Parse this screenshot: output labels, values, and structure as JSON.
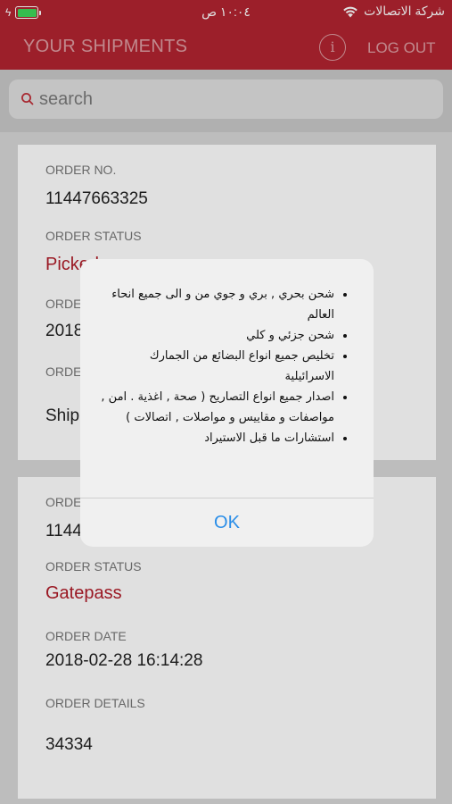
{
  "status_bar": {
    "carrier": "شركة الاتصالات",
    "time": "١٠:٠٤ ص",
    "battery_level": 1.0,
    "battery_color": "#3ed85a"
  },
  "navbar": {
    "title": "YOUR SHIPMENTS",
    "info_glyph": "i",
    "logout_label": "LOG OUT",
    "background": "#b22430"
  },
  "search": {
    "placeholder": "search",
    "value": ""
  },
  "orders": [
    {
      "order_no_label": "ORDER NO.",
      "order_no": "11447663325",
      "status_label": "ORDER STATUS",
      "status": "Picked",
      "date_label": "ORDER DATE",
      "date": "2018",
      "details_label": "ORDER DETAILS",
      "details": "Ship"
    },
    {
      "order_no_label": "ORDER NO.",
      "order_no": "1144",
      "status_label": "ORDER STATUS",
      "status": "Gatepass",
      "date_label": "ORDER DATE",
      "date": "2018-02-28 16:14:28",
      "details_label": "ORDER DETAILS",
      "details": "34334"
    }
  ],
  "alert": {
    "items": [
      "شحن بحري , بري و جوي من و الى جميع انحاء العالم",
      "شحن جزئي و كلي",
      "تخليص جميع انواع البضائع من الجمارك الاسرائيلية",
      "اصدار جميع انواع التصاريح ( صحة , اغذية . امن , مواصفات و مقاييس و مواصلات , اتصالات )",
      "استشارات ما قبل الاستيراد"
    ],
    "ok_label": "OK",
    "ok_color": "#2a8ee8"
  }
}
